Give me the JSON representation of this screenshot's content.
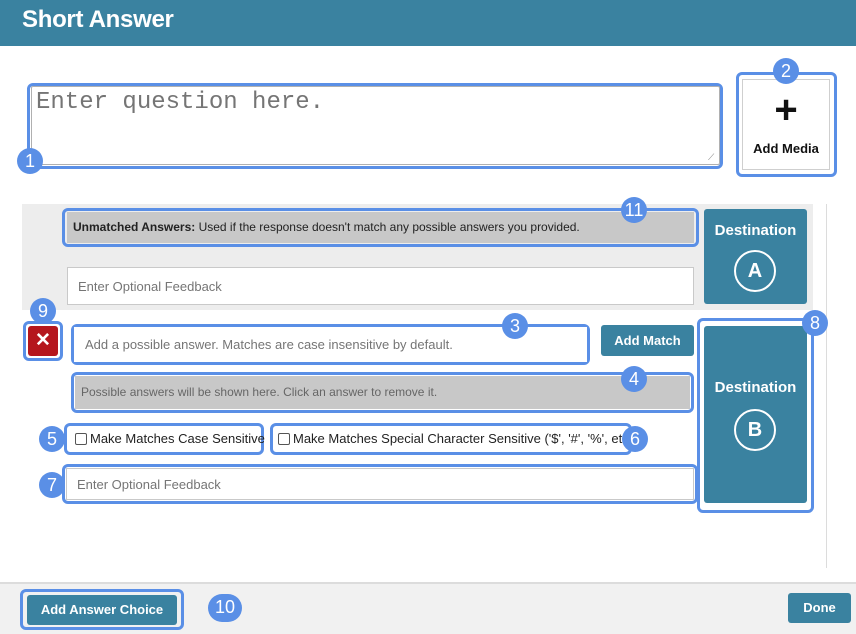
{
  "header": {
    "title": "Short Answer"
  },
  "question": {
    "placeholder": "Enter question here."
  },
  "media": {
    "icon": "plus-icon",
    "glyph": "+",
    "label": "Add Media"
  },
  "unmatched": {
    "label_bold": "Unmatched Answers:",
    "label_text": " Used if the response doesn't match any possible answers you provided.",
    "feedback_placeholder": "Enter Optional Feedback",
    "destination_label": "Destination",
    "destination_letter": "A"
  },
  "answer_choice": {
    "delete_glyph": "✕",
    "answer_placeholder": "Add a possible answer. Matches are case insensitive by default.",
    "add_match_label": "Add Match",
    "possible_answers_hint": "Possible answers will be shown here. Click an answer to remove it.",
    "case_sensitive_label": "Make Matches Case Sensitive",
    "special_char_label": "Make Matches Special Character Sensitive ('$', '#', '%', etc.)",
    "feedback_placeholder": "Enter Optional Feedback",
    "destination_label": "Destination",
    "destination_letter": "B"
  },
  "footer": {
    "add_choice_label": "Add Answer Choice",
    "done_label": "Done"
  },
  "annotations": [
    "1",
    "2",
    "3",
    "4",
    "5",
    "6",
    "7",
    "8",
    "9",
    "10",
    "11"
  ],
  "colors": {
    "header": "#3a82a0",
    "annotation": "#5a8fe6",
    "delete": "#b5161d"
  }
}
